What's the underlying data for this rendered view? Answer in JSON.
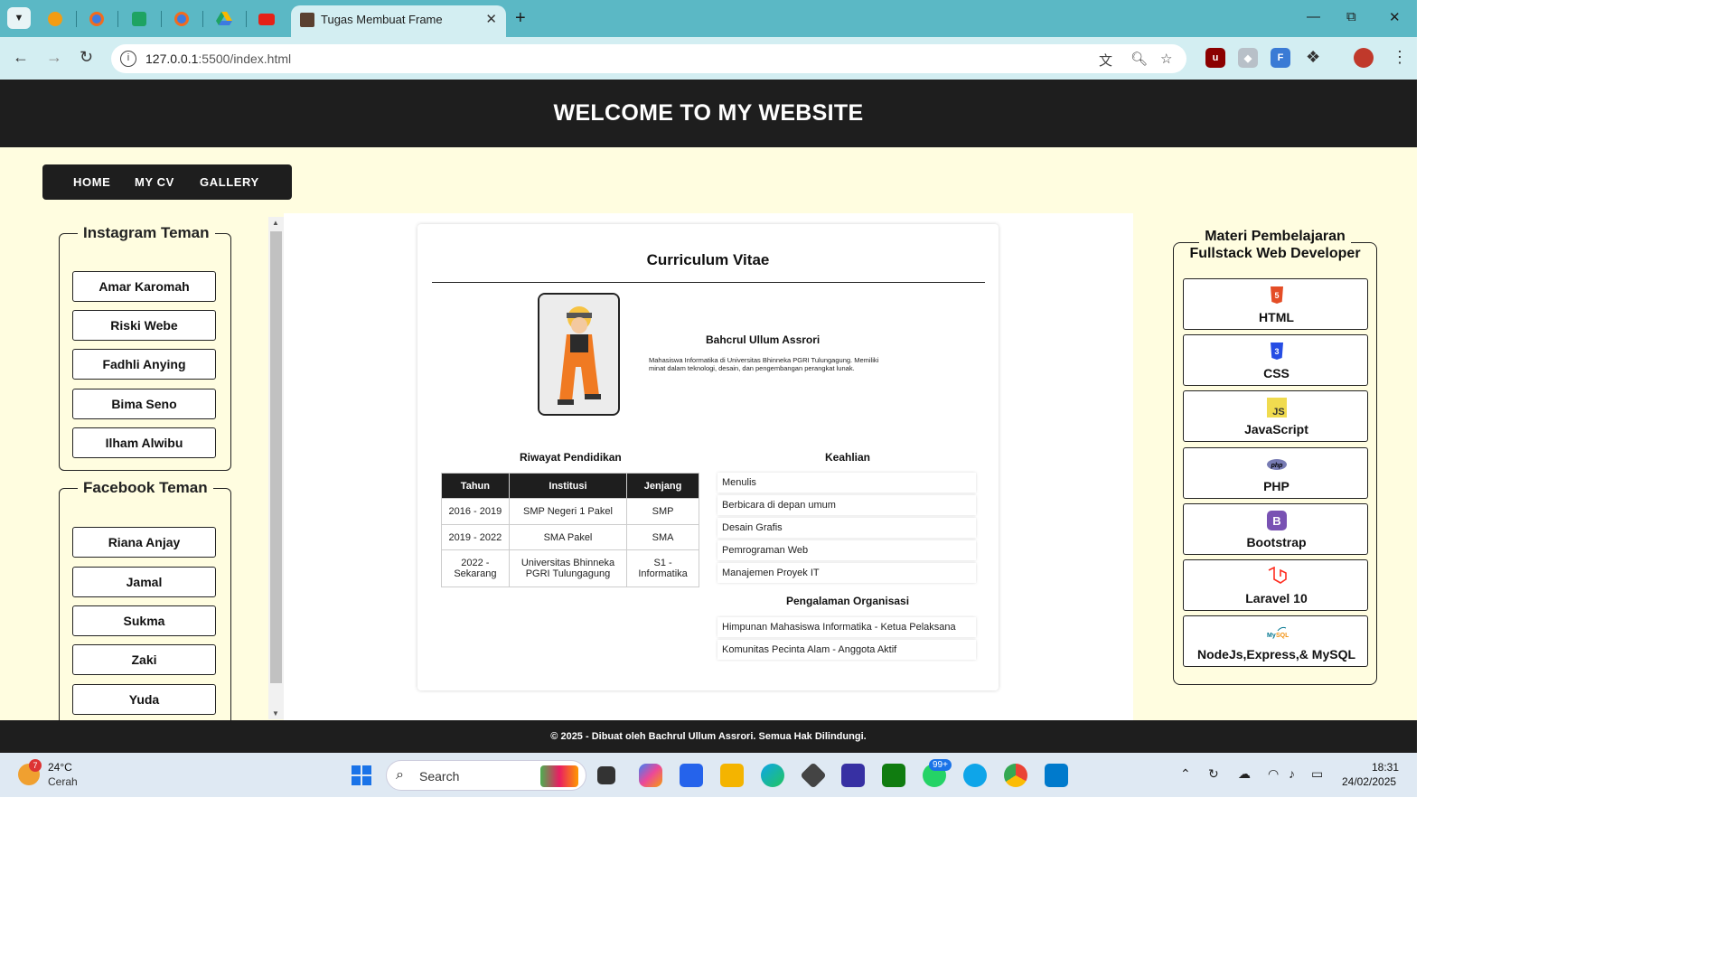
{
  "browser": {
    "tab_title": "Tugas Membuat Frame",
    "url_host": "127.0.0.1",
    "url_rest": ":5500/index.html"
  },
  "site": {
    "header_title": "WELCOME TO MY WEBSITE",
    "nav": [
      "HOME",
      "MY CV",
      "GALLERY"
    ],
    "instagram": {
      "legend": "Instagram Teman",
      "items": [
        "Amar Karomah",
        "Riski Webe",
        "Fadhli Anying",
        "Bima Seno",
        "Ilham Alwibu"
      ]
    },
    "facebook": {
      "legend": "Facebook Teman",
      "items": [
        "Riana Anjay",
        "Jamal",
        "Sukma",
        "Zaki",
        "Yuda"
      ]
    },
    "cv": {
      "title": "Curriculum Vitae",
      "name": "Bahcrul Ullum Assrori",
      "description": "Mahasiswa Informatika di Universitas Bhinneka PGRI Tulungagung. Memiliki minat dalam teknologi, desain, dan pengembangan perangkat lunak.",
      "education_title": "Riwayat Pendidikan",
      "education_headers": [
        "Tahun",
        "Institusi",
        "Jenjang"
      ],
      "education_rows": [
        [
          "2016 - 2019",
          "SMP Negeri 1 Pakel",
          "SMP"
        ],
        [
          "2019 - 2022",
          "SMA Pakel",
          "SMA"
        ],
        [
          "2022 - Sekarang",
          "Universitas Bhinneka PGRI Tulungagung",
          "S1 - Informatika"
        ]
      ],
      "skills_title": "Keahlian",
      "skills": [
        "Menulis",
        "Berbicara di depan umum",
        "Desain Grafis",
        "Pemrograman Web",
        "Manajemen Proyek IT"
      ],
      "org_title": "Pengalaman Organisasi",
      "orgs": [
        "Himpunan Mahasiswa Informatika - Ketua Pelaksana",
        "Komunitas Pecinta Alam - Anggota Aktif"
      ]
    },
    "materi": {
      "title_line1": "Materi Pembelajaran",
      "title_line2": "Fullstack Web Developer",
      "items": [
        {
          "label": "HTML",
          "icon": "html5-icon",
          "color": "#e44d26"
        },
        {
          "label": "CSS",
          "icon": "css3-icon",
          "color": "#264de4"
        },
        {
          "label": "JavaScript",
          "icon": "javascript-icon",
          "color": "#f0db4f"
        },
        {
          "label": "PHP",
          "icon": "php-icon",
          "color": "#777bb3"
        },
        {
          "label": "Bootstrap",
          "icon": "bootstrap-icon",
          "color": "#7952b3"
        },
        {
          "label": "Laravel 10",
          "icon": "laravel-icon",
          "color": "#ff2d20"
        },
        {
          "label": "NodeJs,Express,& MySQL",
          "icon": "mysql-icon",
          "color": "#00758f"
        }
      ]
    },
    "footer": "© 2025 - Dibuat oleh Bachrul Ullum Assrori. Semua Hak Dilindungi."
  },
  "taskbar": {
    "weather_badge": "7",
    "weather_temp": "24°C",
    "weather_cond": "Cerah",
    "search_placeholder": "Search",
    "whatsapp_badge": "99+",
    "time": "18:31",
    "date": "24/02/2025"
  }
}
